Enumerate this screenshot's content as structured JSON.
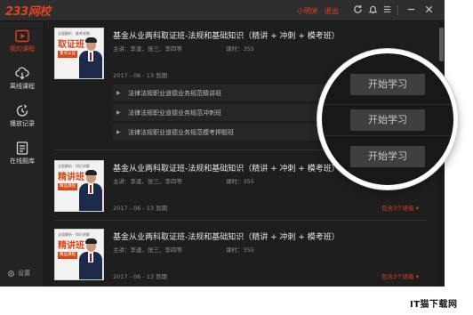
{
  "app": {
    "logo_text": "233网校"
  },
  "header": {
    "user_name": "小明米",
    "logout_label": "退出",
    "icons": [
      "refresh-icon",
      "notification-icon",
      "menu-icon",
      "minimize-icon",
      "close-icon"
    ]
  },
  "sidebar": {
    "items": [
      {
        "label": "我的课程",
        "icon": "video-play-icon",
        "active": true
      },
      {
        "label": "离线课程",
        "icon": "cloud-download-icon",
        "active": false
      },
      {
        "label": "播放记录",
        "icon": "history-clock-icon",
        "active": false
      },
      {
        "label": "在线题库",
        "icon": "question-bank-icon",
        "active": false
      }
    ],
    "settings_label": "设置"
  },
  "courses": [
    {
      "thumb": {
        "tags": "全面解析 · 备考攻略",
        "title": "取证班",
        "badge": "重点认证"
      },
      "title": "基金从业两科取证班-法规和基础知识（精讲 + 冲刺 + 模考班）",
      "meta": "主讲：李逢、张三、李四等",
      "hours": "课时：355",
      "date": "2017 - 06 - 13 到期",
      "expand_label": "",
      "lessons": [
        "法律法规职业道德业务规范精讲班",
        "法律法规职业道德业务规范冲刺班",
        "法律法规职业道德业务规范模考押题班"
      ]
    },
    {
      "thumb": {
        "tags": "全面解析 · 知识讲解",
        "title": "精讲班",
        "badge": "精品课程"
      },
      "title": "基金从业两科取证班-法规和基础知识（精讲 + 冲刺 + 模考班）",
      "meta": "主讲：李逢、张三、李四等",
      "hours": "课时：355",
      "date": "2017 - 06 - 13 到期",
      "expand_label": "包含3个班级 ▾"
    },
    {
      "thumb": {
        "tags": "全面解析 · 知识讲解",
        "title": "精讲班",
        "badge": "精品课程"
      },
      "title": "基金从业两科取证班-法规和基础知识（精讲 + 冲刺 + 模考班）",
      "meta": "主讲：李逢、张三、李四等",
      "hours": "课时：355",
      "date": "2017 - 06 - 13 到期",
      "expand_label": "包含3个班级 ▾"
    }
  ],
  "zoom": {
    "buttons": [
      "开始学习",
      "开始学习",
      "开始学习"
    ]
  },
  "watermark": {
    "text": "IT猫下载网"
  },
  "colors": {
    "accent": "#e0411f",
    "background": "#1e1e1e",
    "button_bg": "#3f3f3f"
  }
}
